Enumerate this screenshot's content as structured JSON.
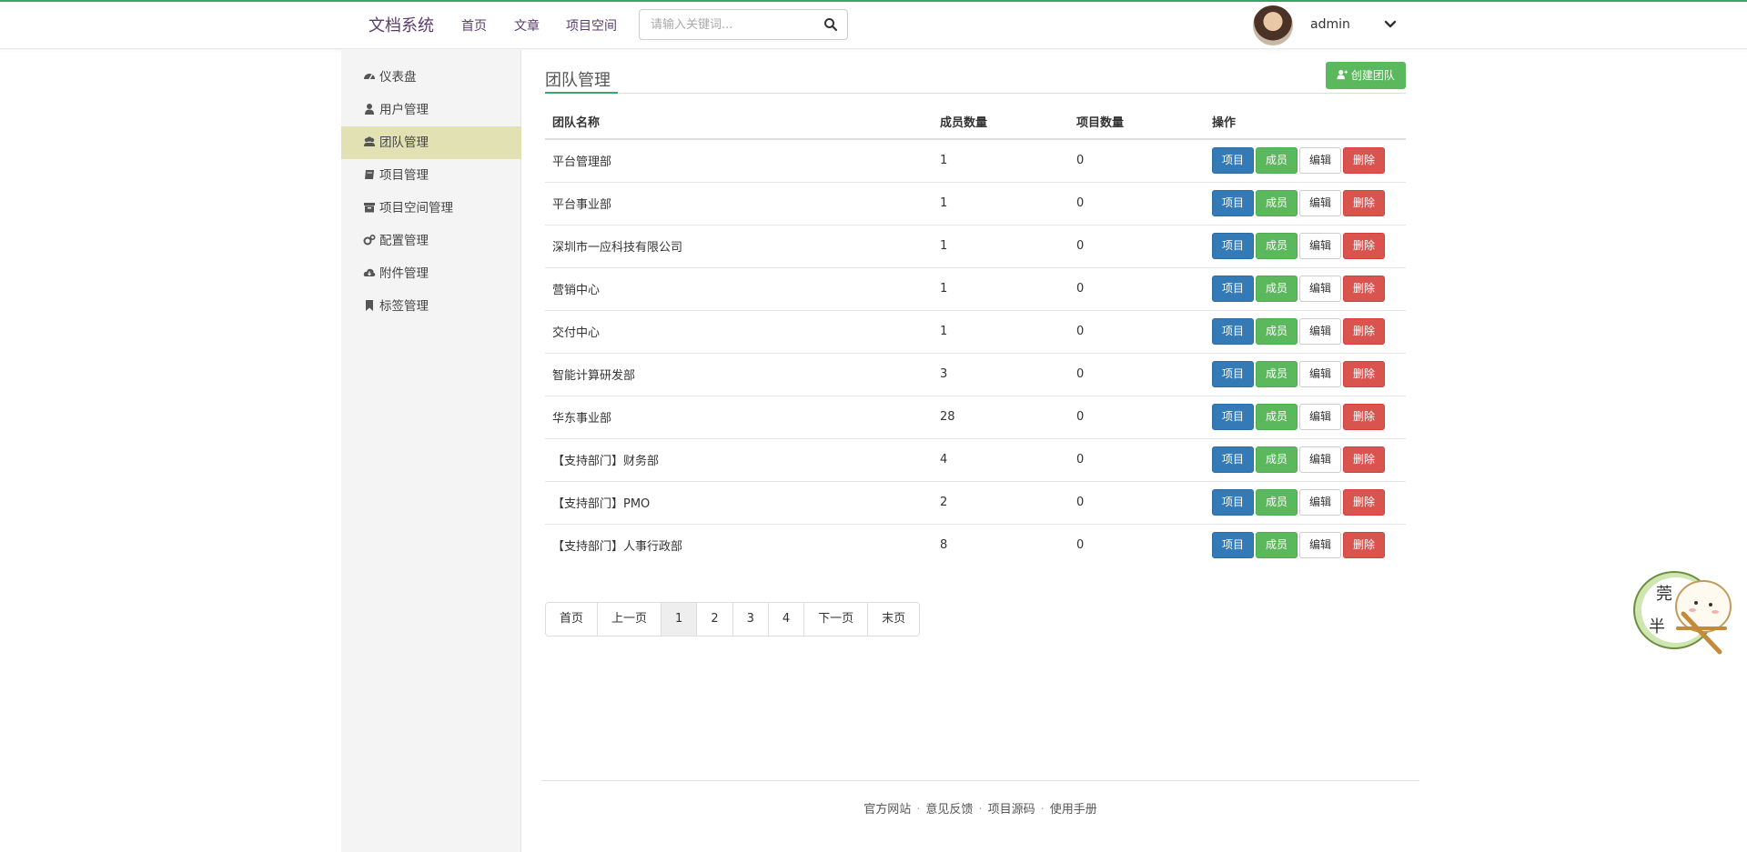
{
  "header": {
    "brand": "文档系统",
    "nav": [
      "首页",
      "文章",
      "项目空间"
    ],
    "search_placeholder": "请输入关键词...",
    "username": "admin"
  },
  "sidebar": {
    "items": [
      {
        "label": "仪表盘",
        "icon": "dashboard-icon"
      },
      {
        "label": "用户管理",
        "icon": "user-icon"
      },
      {
        "label": "团队管理",
        "icon": "users-icon"
      },
      {
        "label": "项目管理",
        "icon": "book-icon"
      },
      {
        "label": "项目空间管理",
        "icon": "archive-icon"
      },
      {
        "label": "配置管理",
        "icon": "cogs-icon"
      },
      {
        "label": "附件管理",
        "icon": "cloud-download-icon"
      },
      {
        "label": "标签管理",
        "icon": "bookmark-icon"
      }
    ],
    "active_index": 2
  },
  "main": {
    "title": "团队管理",
    "create_button": "创建团队",
    "columns": [
      "团队名称",
      "成员数量",
      "项目数量",
      "操作"
    ],
    "actions": [
      "项目",
      "成员",
      "编辑",
      "删除"
    ],
    "rows": [
      {
        "name": "平台管理部",
        "members": "1",
        "projects": "0"
      },
      {
        "name": "平台事业部",
        "members": "1",
        "projects": "0"
      },
      {
        "name": "深圳市一应科技有限公司",
        "members": "1",
        "projects": "0"
      },
      {
        "name": "营销中心",
        "members": "1",
        "projects": "0"
      },
      {
        "name": "交付中心",
        "members": "1",
        "projects": "0"
      },
      {
        "name": "智能计算研发部",
        "members": "3",
        "projects": "0"
      },
      {
        "name": "华东事业部",
        "members": "28",
        "projects": "0"
      },
      {
        "name": "【支持部门】财务部",
        "members": "4",
        "projects": "0"
      },
      {
        "name": "【支持部门】PMO",
        "members": "2",
        "projects": "0"
      },
      {
        "name": "【支持部门】人事行政部",
        "members": "8",
        "projects": "0"
      }
    ]
  },
  "pagination": {
    "items": [
      "首页",
      "上一页",
      "1",
      "2",
      "3",
      "4",
      "下一页",
      "末页"
    ],
    "current": "1"
  },
  "footer": {
    "links": [
      "官方网站",
      "意见反馈",
      "项目源码",
      "使用手册"
    ]
  },
  "mascot": {
    "text1": "莞",
    "text2": "半"
  },
  "colors": {
    "accent": "#3aa76d",
    "primary": "#337ab7",
    "success": "#5cb85c",
    "danger": "#d9534f",
    "sidebar_active": "#e1e1b4"
  }
}
